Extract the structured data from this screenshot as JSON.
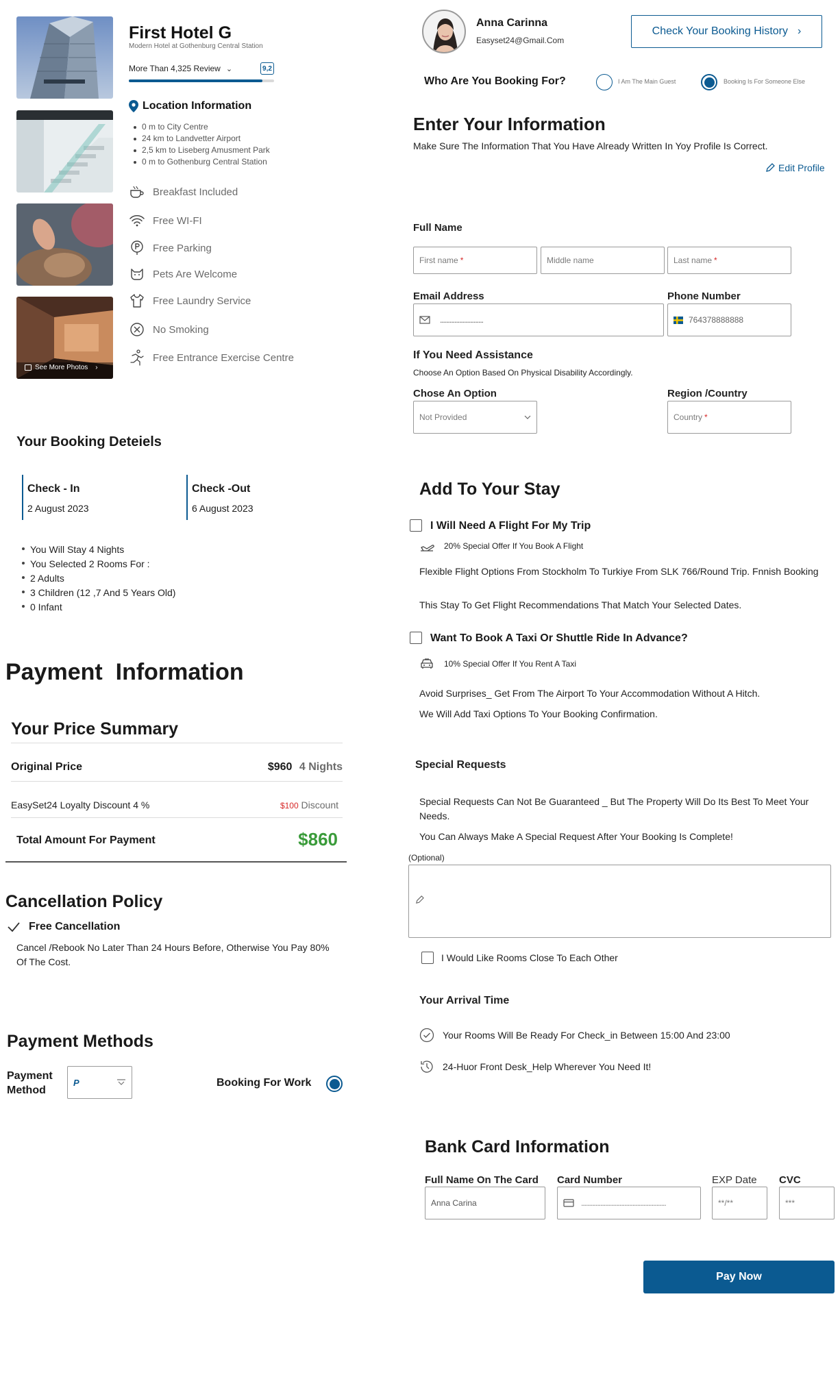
{
  "hotel": {
    "name": "First Hotel G",
    "subtitle": "Modern Hotel at Gothenburg Central Station",
    "reviews_label": "More Than 4,325 Review",
    "rating": "9,2",
    "rating_fraction": 0.92,
    "see_more_photos": "See More Photos"
  },
  "location": {
    "title": "Location Information",
    "items": [
      "0 m to City Centre",
      "24 km to Landvetter Airport",
      "2,5 km to Liseberg Amusment Park",
      "0 m to Gothenburg Central Station"
    ]
  },
  "amenities": [
    {
      "icon": "coffee-cup-icon",
      "label": "Breakfast Included"
    },
    {
      "icon": "wifi-icon",
      "label": "Free WI-FI"
    },
    {
      "icon": "parking-icon",
      "label": "Free Parking"
    },
    {
      "icon": "pet-icon",
      "label": "Pets Are Welcome"
    },
    {
      "icon": "laundry-shirt-icon",
      "label": "Free Laundry Service"
    },
    {
      "icon": "no-smoking-icon",
      "label": "No Smoking"
    },
    {
      "icon": "exercise-icon",
      "label": "Free Entrance Exercise Centre"
    }
  ],
  "user": {
    "name": "Anna Carinna",
    "email": "Easyset24@Gmail.Com",
    "history_button": "Check Your Booking History"
  },
  "booking_for": {
    "question": "Who Are You Booking For?",
    "option_main": "I Am The Main Guest",
    "option_other": "Booking Is For Someone Else",
    "selected": "option_other"
  },
  "info": {
    "title": "Enter Your Information",
    "subtitle": "Make Sure The Information That You Have Already Written In Yoy Profile Is Correct.",
    "edit_profile": "Edit Profile",
    "full_name_label": "Full Name",
    "first_name_ph": "First name",
    "middle_name_ph": "Middle name",
    "last_name_ph": "Last name",
    "required_mark": "*",
    "email_label": "Email Address",
    "email_value": "...........................",
    "phone_label": "Phone Number",
    "phone_value": "764378888888",
    "assist_title": "If You Need Assistance",
    "assist_sub": "Choose An Option Based On Physical Disability Accordingly.",
    "option_label": "Chose An Option",
    "option_value": "Not Provided",
    "region_label": "Region /Country",
    "country_ph": "Country"
  },
  "booking_details": {
    "title": "Your Booking Deteiels",
    "checkin_label": "Check - In",
    "checkin_date": "2 August 2023",
    "checkout_label": "Check -Out",
    "checkout_date": "6 August 2023",
    "items": [
      "You Will Stay 4 Nights",
      "You Selected 2 Rooms For :",
      "2 Adults",
      "3 Children (12 ,7 And 5 Years Old)",
      "0 Infant"
    ]
  },
  "payment": {
    "title": "Payment  Information",
    "summary_title": "Your Price Summary",
    "original_label": "Original Price",
    "original_price": "$960",
    "nights": "4 Nights",
    "discount_label": "EasySet24 Loyalty Discount 4 %",
    "discount_amount": "$100",
    "discount_word": "Discount",
    "total_label": "Total Amount For Payment",
    "total_value": "$860"
  },
  "cancellation": {
    "title": "Cancellation Policy",
    "free_label": "Free Cancellation",
    "text": "Cancel /Rebook No Later Than 24 Hours Before, Otherwise You Pay 80% Of The Cost."
  },
  "payment_methods": {
    "title": "Payment Methods",
    "method_label": "Payment Method",
    "booking_for_work": "Booking For Work"
  },
  "add_stay": {
    "title": "Add To Your Stay",
    "flight_label": "I Will Need A Flight For My Trip",
    "flight_offer": "20% Special Offer If You Book A Flight",
    "flight_desc1": "Flexible Flight Options From Stockholm To Turkiye From SLK 766/Round Trip. Fnnish Booking",
    "flight_desc2": "This Stay To Get Flight Recommendations That Match Your Selected Dates.",
    "taxi_label": "Want To Book A Taxi Or Shuttle Ride In Advance?",
    "taxi_offer": "10% Special Offer If You Rent A Taxi",
    "taxi_desc1": "Avoid Surprises_ Get From The Airport To Your Accommodation Without A Hitch.",
    "taxi_desc2": "We Will Add Taxi Options To Your Booking Confirmation."
  },
  "special": {
    "title": "Special Requests",
    "desc1": "Special Requests Can Not Be Guaranteed _ But The Property Will Do Its Best To Meet Your Needs.",
    "desc2": "You Can Always Make A Special Request After Your Booking Is Complete!",
    "optional": "(Optional)",
    "rooms_close": "I Would Like Rooms Close To Each Other"
  },
  "arrival": {
    "title": "Your Arrival Time",
    "ready": "Your Rooms Will Be Ready For Check_in Between 15:00 And 23:00",
    "front_desk": "24-Huor Front Desk_Help Wherever You Need It!"
  },
  "bank": {
    "title": "Bank Card Information",
    "name_label": "Full Name On The Card",
    "name_value": "Anna Carina",
    "number_label": "Card Number",
    "number_value": ".....................................................",
    "exp_label": "EXP Date",
    "exp_ph": "**/**",
    "cvc_label": "CVC",
    "cvc_ph": "***",
    "pay_button": "Pay Now"
  },
  "colors": {
    "accent": "#0b5a91",
    "green": "#3a9b3a",
    "red": "#d62828"
  }
}
